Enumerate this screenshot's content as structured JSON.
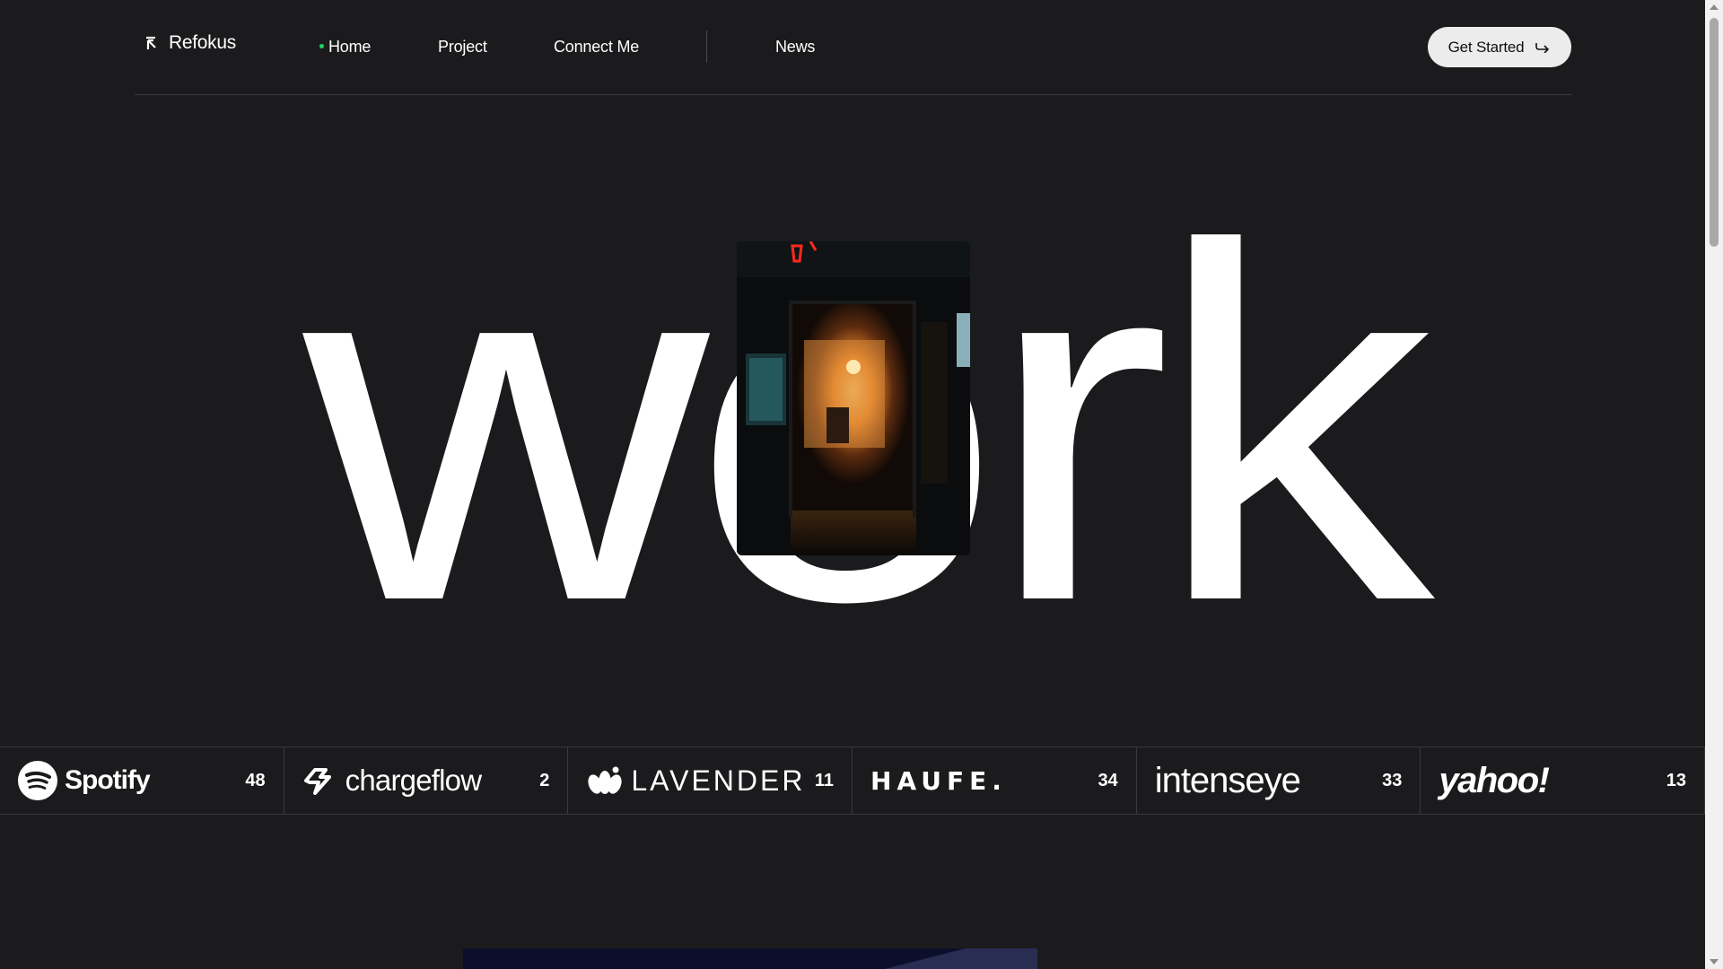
{
  "brand": {
    "name": "Refokus",
    "icon": "refokus-arrow-icon"
  },
  "nav": {
    "home": "Home",
    "project": "Project",
    "connect": "Connect Me",
    "news": "News"
  },
  "cta": {
    "label": "Get Started",
    "icon": "arrow-hook-right-icon"
  },
  "hero": {
    "word": "work"
  },
  "logos": [
    {
      "name": "Spotify",
      "count": "48"
    },
    {
      "name": "chargeflow",
      "count": "2"
    },
    {
      "name": "LAVENDER",
      "count": "11"
    },
    {
      "name": "HAUFE.",
      "count": "34"
    },
    {
      "name": "intenseye",
      "count": "33"
    },
    {
      "name": "yahoo!",
      "count": "13"
    }
  ],
  "colors": {
    "background": "#1b1b1d",
    "accent_dot": "#1ed760",
    "cta_bg": "#ececec"
  }
}
